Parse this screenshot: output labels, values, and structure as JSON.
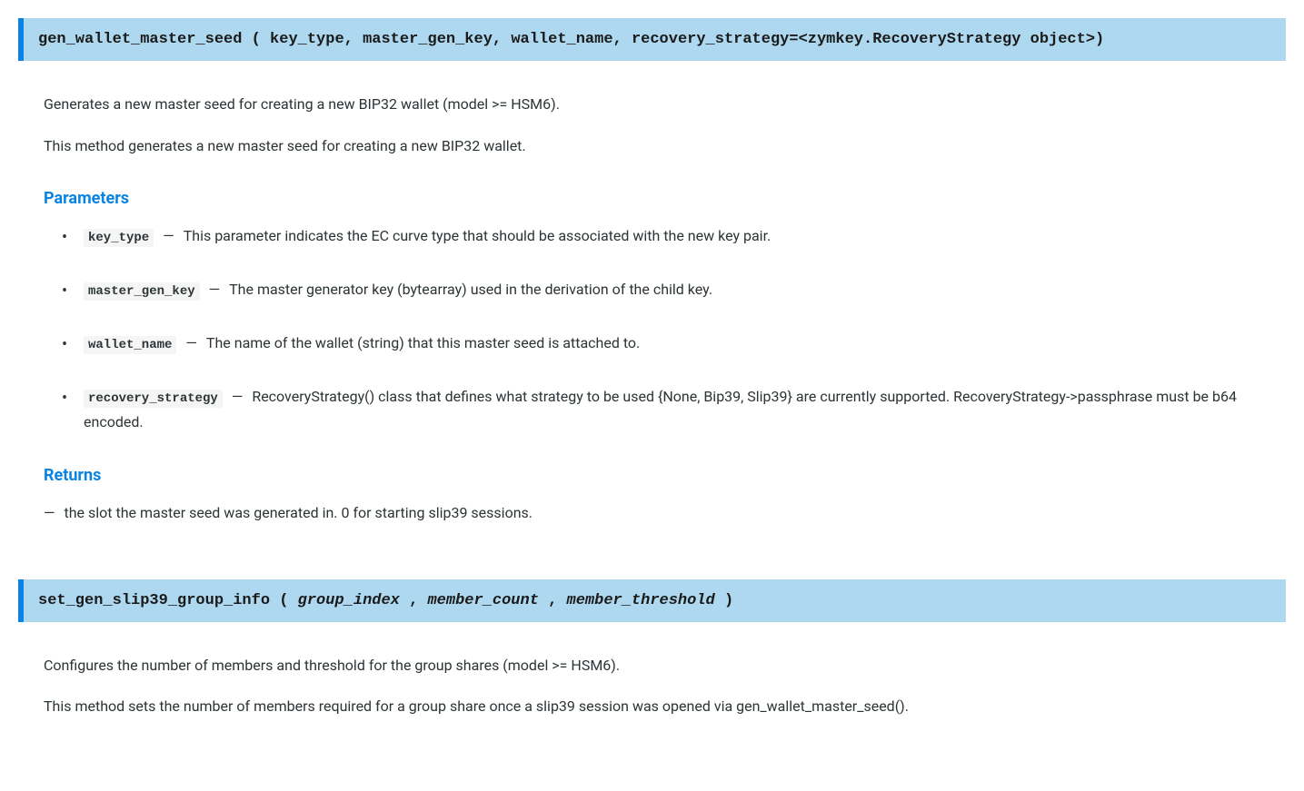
{
  "func1": {
    "name": "gen_wallet_master_seed",
    "sig_open": " ( ",
    "sig_close": ")",
    "params": [
      {
        "name": "key_type",
        "sep": ", "
      },
      {
        "name": "master_gen_key",
        "sep": ", "
      },
      {
        "name": "wallet_name",
        "sep": ", "
      },
      {
        "name": "recovery_strategy",
        "sep": ""
      }
    ],
    "default_marker": "=",
    "default_value": "<zymkey.RecoveryStrategy object>",
    "desc1": "Generates a new master seed for creating a new BIP32 wallet (model >= HSM6).",
    "desc2": "This method generates a new master seed for creating a new BIP32 wallet.",
    "parameters_heading": "Parameters",
    "param_details": [
      {
        "name": "key_type",
        "desc": "This parameter indicates the EC curve type that should be associated with the new key pair."
      },
      {
        "name": "master_gen_key",
        "desc": "The master generator key (bytearray) used in the derivation of the child key."
      },
      {
        "name": "wallet_name",
        "desc": "The name of the wallet (string) that this master seed is attached to."
      },
      {
        "name": "recovery_strategy",
        "desc": "RecoveryStrategy() class that defines what strategy to be used {None, Bip39, Slip39} are currently supported. RecoveryStrategy->passphrase must be b64 encoded."
      }
    ],
    "returns_heading": "Returns",
    "returns_desc": "the slot the master seed was generated in. 0 for starting slip39 sessions."
  },
  "func2": {
    "name": "set_gen_slip39_group_info",
    "sig_open": " ( ",
    "sig_close": " )",
    "params": [
      {
        "name": "group_index",
        "sep": " , "
      },
      {
        "name": "member_count",
        "sep": " , "
      },
      {
        "name": "member_threshold",
        "sep": ""
      }
    ],
    "desc1": "Configures the number of members and threshold for the group shares (model >= HSM6).",
    "desc2": "This method sets the number of members required for a group share once a slip39 session was opened via gen_wallet_master_seed()."
  },
  "mdash": "—"
}
